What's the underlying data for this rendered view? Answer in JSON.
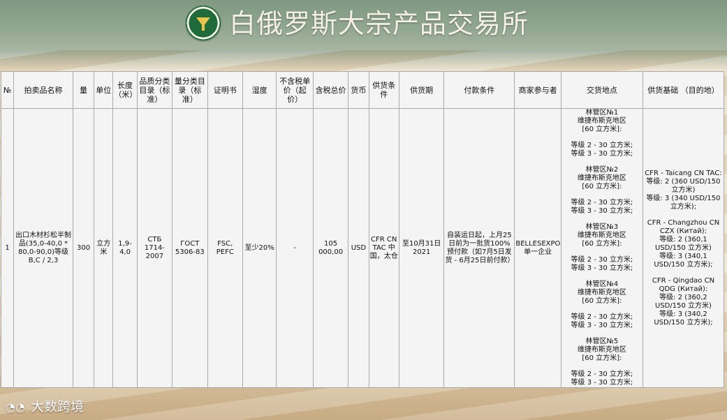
{
  "title": "白俄罗斯大宗产品交易所",
  "footer_logo": "大数跨境",
  "headers": [
    "№",
    "拍卖品名称",
    "量",
    "单位",
    "长度（米）",
    "品质分类目录（标准）",
    "量分类目录（标准）",
    "证明书",
    "湿度",
    "不含税单价（起价）",
    "含税总价",
    "货币",
    "供货条件",
    "供货期",
    "付款条件",
    "商家参与者",
    "交货地点",
    "供货基础 （目的地）"
  ],
  "row": {
    "no": "1",
    "name": "出口木材杉松半制品(35,0-40,0 * 80,0-90,0)等级 B,C / 2,3",
    "qty": "300",
    "unit": "立方米",
    "length": "1,9-4,0",
    "quality_std": "СТБ 1714-2007",
    "qty_std": "ГОСТ 5306-83",
    "cert": "FSC, PEFC",
    "humidity": "至少20%",
    "price_ex_tax": "-",
    "total_incl_tax": "105 000,00",
    "currency": "USD",
    "delivery_terms": "CFR CN TAC 中国，太仓",
    "delivery_period": "至10月31日2021",
    "payment_terms": "自装运日起，上月25日前为一批货100%预付款（如7月5日发货 - 6月25日前付款）",
    "seller": "BELLESEXPORT 单一企业",
    "locations": [
      {
        "name": "林管区№1",
        "region": "维捷布斯克地区",
        "volume": "[60 立方米]:",
        "grade2": "等级 2 - 30 立方米;",
        "grade3": "等级 3 - 30 立方米;"
      },
      {
        "name": "林管区№2",
        "region": "维捷布斯克地区",
        "volume": "[60 立方米]:",
        "grade2": "等级 2 - 30 立方米;",
        "grade3": "等级 3 - 30 立方米;"
      },
      {
        "name": "林管区№3",
        "region": "维捷布斯克地区",
        "volume": "[60 立方米]:",
        "grade2": "等级 2 - 30 立方米;",
        "grade3": "等级 3 - 30 立方米;"
      },
      {
        "name": "林管区№4",
        "region": "维捷布斯克地区",
        "volume": "[60 立方米]:",
        "grade2": "等级 2 - 30 立方米;",
        "grade3": "等级 3 - 30 立方米;"
      },
      {
        "name": "林管区№5",
        "region": "维捷布斯克地区",
        "volume": "[60 立方米]:",
        "grade2": "等级 2 - 30 立方米;",
        "grade3": "等级 3 - 30 立方米;"
      }
    ],
    "basis": [
      {
        "port": "CFR - Taicang CN TAC:",
        "grade2": "等级: 2 (360 USD/150 立方米)",
        "grade3": "等级: 3 (340 USD/150 立方米);"
      },
      {
        "port": "CFR - Changzhou CN CZX (Китай):",
        "grade2": "等级: 2 (360,1 USD/150 立方米)",
        "grade3": "等级: 3 (340,1 USD/150 立方米);"
      },
      {
        "port": "CFR - Qingdao CN QDG (Китай):",
        "grade2": "等级: 2 (360,2 USD/150 立方米)",
        "grade3": "等级: 3 (340,2 USD/150 立方米);"
      }
    ]
  },
  "colors": {
    "header_green": "#8ea08b",
    "table_bg": "#f4f4f4",
    "logo_green": "#1f6b3a",
    "logo_gold": "#d8b84a"
  }
}
